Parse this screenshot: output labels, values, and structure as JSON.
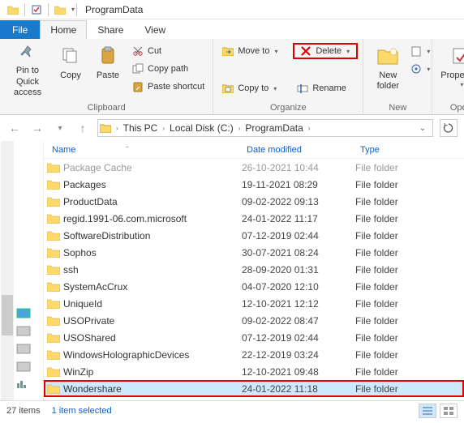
{
  "window": {
    "title": "ProgramData"
  },
  "tabs": {
    "file": "File",
    "home": "Home",
    "share": "Share",
    "view": "View"
  },
  "ribbon": {
    "clipboard": {
      "label": "Clipboard",
      "pin": "Pin to Quick access",
      "copy": "Copy",
      "paste": "Paste",
      "cut": "Cut",
      "copy_path": "Copy path",
      "paste_shortcut": "Paste shortcut"
    },
    "organize": {
      "label": "Organize",
      "move_to": "Move to",
      "copy_to": "Copy to",
      "delete": "Delete",
      "rename": "Rename"
    },
    "new": {
      "label": "New",
      "new_folder": "New folder"
    },
    "open": {
      "label": "Open",
      "properties": "Properties"
    }
  },
  "breadcrumb": {
    "this_pc": "This PC",
    "drive": "Local Disk (C:)",
    "folder": "ProgramData"
  },
  "columns": {
    "name": "Name",
    "date": "Date modified",
    "type": "Type"
  },
  "files": [
    {
      "name": "Package Cache",
      "date": "26-10-2021 10:44",
      "type": "File folder",
      "dim": true
    },
    {
      "name": "Packages",
      "date": "19-11-2021 08:29",
      "type": "File folder"
    },
    {
      "name": "ProductData",
      "date": "09-02-2022 09:13",
      "type": "File folder"
    },
    {
      "name": "regid.1991-06.com.microsoft",
      "date": "24-01-2022 11:17",
      "type": "File folder"
    },
    {
      "name": "SoftwareDistribution",
      "date": "07-12-2019 02:44",
      "type": "File folder"
    },
    {
      "name": "Sophos",
      "date": "30-07-2021 08:24",
      "type": "File folder"
    },
    {
      "name": "ssh",
      "date": "28-09-2020 01:31",
      "type": "File folder"
    },
    {
      "name": "SystemAcCrux",
      "date": "04-07-2020 12:10",
      "type": "File folder"
    },
    {
      "name": "UniqueId",
      "date": "12-10-2021 12:12",
      "type": "File folder"
    },
    {
      "name": "USOPrivate",
      "date": "09-02-2022 08:47",
      "type": "File folder"
    },
    {
      "name": "USOShared",
      "date": "07-12-2019 02:44",
      "type": "File folder"
    },
    {
      "name": "WindowsHolographicDevices",
      "date": "22-12-2019 03:24",
      "type": "File folder"
    },
    {
      "name": "WinZip",
      "date": "12-10-2021 09:48",
      "type": "File folder"
    },
    {
      "name": "Wondershare",
      "date": "24-01-2022 11:18",
      "type": "File folder",
      "selected": true,
      "highlight": true
    }
  ],
  "status": {
    "count": "27 items",
    "selection": "1 item selected"
  }
}
